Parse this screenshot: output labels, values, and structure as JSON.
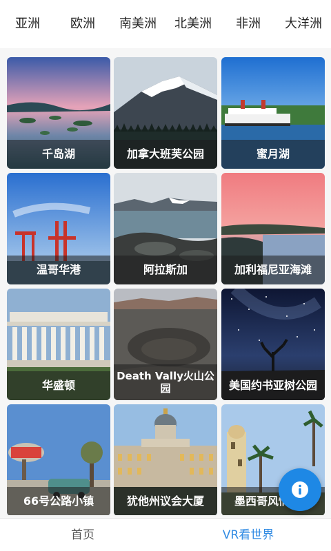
{
  "tabs": [
    "亚洲",
    "欧洲",
    "南美洲",
    "北美洲",
    "非洲",
    "大洋洲"
  ],
  "places": [
    {
      "name": "千岛湖"
    },
    {
      "name": "加拿大班芙公园"
    },
    {
      "name": "蜜月湖"
    },
    {
      "name": "温哥华港"
    },
    {
      "name": "阿拉斯加"
    },
    {
      "name": "加利福尼亚海滩"
    },
    {
      "name": "华盛顿"
    },
    {
      "name": "Death Vally火山公园"
    },
    {
      "name": "美国约书亚树公园"
    },
    {
      "name": "66号公路小镇"
    },
    {
      "name": "犹他州议会大厦"
    },
    {
      "name": "墨西哥风情小镇"
    }
  ],
  "bottom_nav": {
    "home": "首页",
    "vr": "VR看世界"
  },
  "fab_icon": "info-icon",
  "colors": {
    "accent": "#1e88e5",
    "nav_active": "#2f8ae3"
  }
}
